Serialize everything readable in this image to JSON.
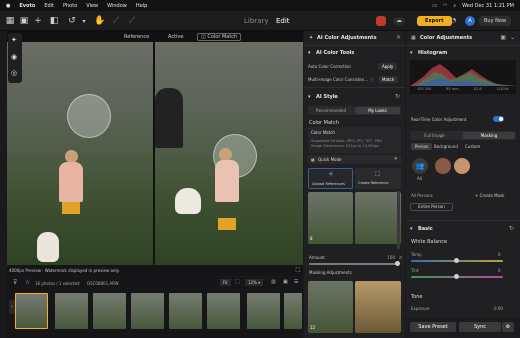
{
  "menubar": {
    "app": "Evoto",
    "items": [
      "Edit",
      "Photo",
      "View",
      "Window",
      "Help"
    ],
    "clock": "Wed Dec 31 1:21 PM"
  },
  "toolbar": {
    "tab_library": "Library",
    "tab_edit": "Edit",
    "export_label": "Export",
    "buy_label": "Buy Now",
    "avatar_initial": "A"
  },
  "viewer": {
    "label_reference": "Reference",
    "label_active": "Active",
    "label_color_match": "Color Match",
    "preview_note": "4000px Preview · Watermark displayed in preview only."
  },
  "filmstrip": {
    "count_text": "16 photos / 1 selected",
    "filename": "DSC08801.ARW",
    "fit_label": "Fit",
    "zoom_label": "12%"
  },
  "adjust": {
    "title": "AI Color Adjustments",
    "color_tools": "AI Color Tools",
    "auto_label": "Auto Color Correction",
    "auto_btn": "Apply",
    "multi_label": "Multi-image Color Consisten...",
    "multi_btn": "Match",
    "ai_style": "AI Style",
    "tab_recommended": "Recommended",
    "tab_my_looks": "My Looks",
    "color_match": "Color Match",
    "color_match_box_title": "Color Match",
    "color_match_box_desc": "Supported Formats: JPEG, JPG, TIFF, PNG. Image Dimensions: 512px to 10,000px",
    "quick_mode": "Quick Mode",
    "upload_label": "Upload References",
    "create_label": "Create Reference",
    "amount_label": "Amount",
    "amount_value": "100",
    "masking_label": "Masking Adjustments",
    "thumb1_num": "12",
    "thumb2_num": "8"
  },
  "right": {
    "title": "Color Adjustments",
    "histogram": "Histogram",
    "hist_stats": [
      "ISO 200",
      "85 mm",
      "f/2.8",
      "1/200s"
    ],
    "realtime": "Real-Time Color Adjustment",
    "tab_full": "Full Image",
    "tab_masking": "Masking",
    "seg": [
      "Person",
      "Background",
      "Custom"
    ],
    "all_label": "All",
    "all_persons": "All Persons",
    "create_mask": "+ Create Mask",
    "entire_person": "Entire Person",
    "basic": "Basic",
    "white_balance": "White Balance",
    "temp_label": "Temp",
    "temp_value": "0",
    "tint_label": "Tint",
    "tint_value": "0",
    "tone": "Tone",
    "exposure_label": "Exposure",
    "exposure_value": "0.00",
    "save_preset": "Save Preset",
    "sync": "Sync"
  },
  "colors": {
    "accent": "#2e6fd0",
    "export": "#f0b020",
    "panel": "#202022"
  }
}
